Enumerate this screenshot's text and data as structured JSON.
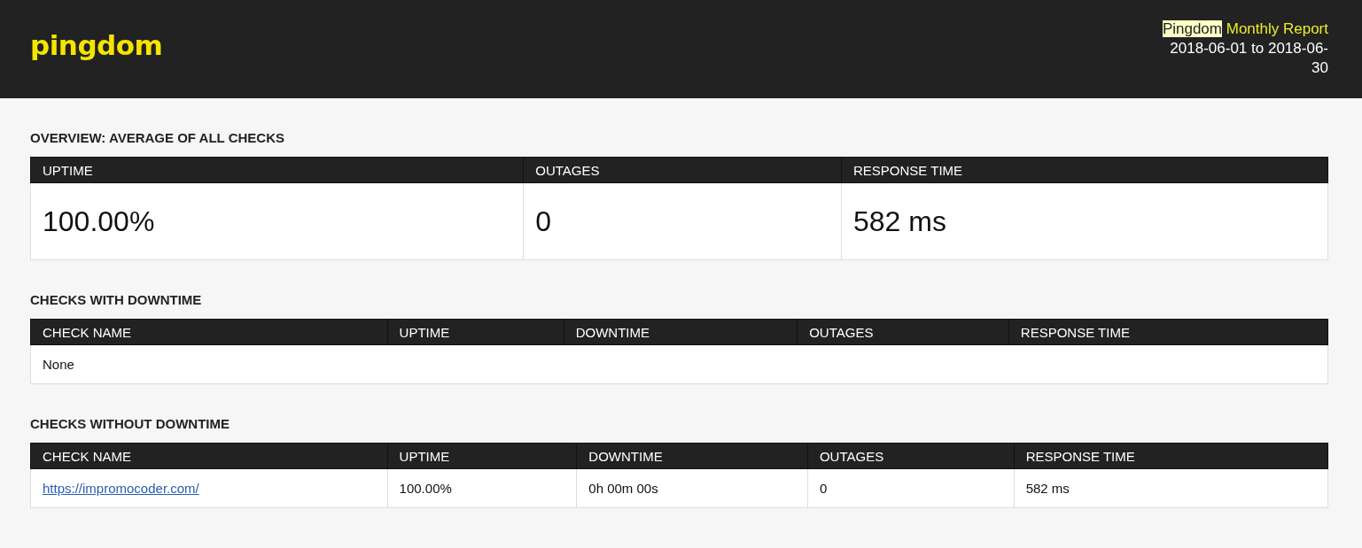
{
  "header": {
    "logo": "pingdom",
    "report_brand": "Pingdom",
    "report_title": "Monthly Report",
    "period": "2018-06-01 to 2018-06-30"
  },
  "sections": [
    {
      "kind": "overview",
      "title": "OVERVIEW: AVERAGE OF ALL CHECKS",
      "columns": [
        "UPTIME",
        "OUTAGES",
        "RESPONSE TIME"
      ],
      "values": [
        "100.00%",
        "0",
        "582 ms"
      ]
    },
    {
      "kind": "checks",
      "title": "CHECKS WITH DOWNTIME",
      "columns": [
        "CHECK NAME",
        "UPTIME",
        "DOWNTIME",
        "OUTAGES",
        "RESPONSE TIME"
      ],
      "empty_message": "None"
    },
    {
      "kind": "checks",
      "title": "CHECKS WITHOUT DOWNTIME",
      "columns": [
        "CHECK NAME",
        "UPTIME",
        "DOWNTIME",
        "OUTAGES",
        "RESPONSE TIME"
      ],
      "rows": [
        {
          "cells": [
            {
              "kind": "link",
              "text": "https://impromocoder.com/"
            },
            {
              "kind": "text",
              "text": "100.00%"
            },
            {
              "kind": "text",
              "text": "0h 00m 00s"
            },
            {
              "kind": "text",
              "text": "0"
            },
            {
              "kind": "text",
              "text": "582 ms"
            }
          ]
        }
      ]
    }
  ]
}
